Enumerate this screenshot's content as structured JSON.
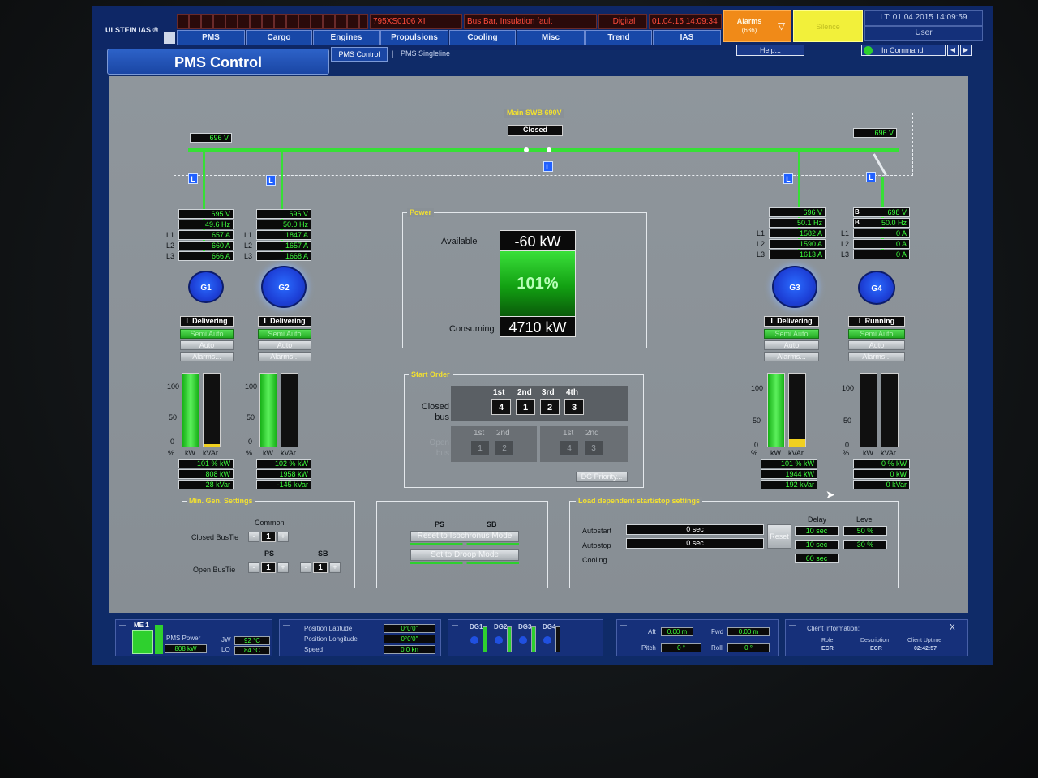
{
  "app": {
    "brand": "ULSTEIN IAS ®"
  },
  "topbar": {
    "alarm_code": "795XS0106 XI",
    "alarm_text": "Bus Bar, Insulation fault",
    "alarm_type": "Digital",
    "alarm_time": "01.04.15 14:09:34",
    "alarms_label": "Alarms",
    "alarms_count": "(636)",
    "silence_label": "Silence",
    "clock": "LT: 01.04.2015 14:09:59",
    "user_label": "User"
  },
  "menu": [
    "PMS",
    "Cargo",
    "Engines",
    "Propulsions",
    "Cooling",
    "Misc",
    "Trend",
    "IAS"
  ],
  "page": {
    "title": "PMS Control",
    "tab_active": "PMS Control",
    "tab_sep": "|",
    "tab_other": "PMS Singleline",
    "help": "Help...",
    "in_command": "In Command"
  },
  "swb": {
    "title": "Main SWB 690V",
    "tie_status": "Closed",
    "left_voltage": "696 V",
    "right_voltage": "696 V",
    "L_label": "L"
  },
  "phase_labels": [
    "L1",
    "L2",
    "L3"
  ],
  "bar_labels": {
    "pct": "%",
    "kw": "kW",
    "kvar": "kVAr",
    "s100": "100",
    "s50": "50",
    "s0": "0"
  },
  "generators": [
    {
      "id": "G1",
      "v": "695 V",
      "hz": "49.6 Hz",
      "l1": "657 A",
      "l2": "660 A",
      "l3": "666 A",
      "status": "L Delivering",
      "mode1": "Semi Auto",
      "mode2": "Auto",
      "alarms": "Alarms...",
      "kw_pct": 101,
      "kvar_pct": 3,
      "pct": "101 % kW",
      "kw": "808 kW",
      "kvar": "28 kVar"
    },
    {
      "id": "G2",
      "v": "696 V",
      "hz": "50.0 Hz",
      "l1": "1847 A",
      "l2": "1657 A",
      "l3": "1668 A",
      "status": "L Delivering",
      "mode1": "Semi Auto",
      "mode2": "Auto",
      "alarms": "Alarms...",
      "kw_pct": 102,
      "kvar_pct": 0,
      "pct": "102 % kW",
      "kw": "1958 kW",
      "kvar": "-145 kVar"
    },
    {
      "id": "G3",
      "v": "696 V",
      "hz": "50.1 Hz",
      "l1": "1582 A",
      "l2": "1590 A",
      "l3": "1613 A",
      "status": "L Delivering",
      "mode1": "Semi Auto",
      "mode2": "Auto",
      "alarms": "Alarms...",
      "kw_pct": 101,
      "kvar_pct": 10,
      "pct": "101 % kW",
      "kw": "1944 kW",
      "kvar": "192 kVar"
    },
    {
      "id": "G4",
      "v": "698 V",
      "hz": "50.0 Hz",
      "l1": "0 A",
      "l2": "0 A",
      "l3": "0 A",
      "status": "L Running",
      "mode1": "Semi Auto",
      "mode2": "Auto",
      "alarms": "Alarms...",
      "kw_pct": 0,
      "kvar_pct": 0,
      "pct": "0 % kW",
      "kw": "0 kW",
      "kvar": "0 kVar",
      "b1": "B",
      "b2": "B"
    }
  ],
  "power": {
    "title": "Power",
    "available_label": "Available",
    "available": "-60 kW",
    "percent": "101%",
    "consuming_label": "Consuming",
    "consuming": "4710 kW"
  },
  "start_order": {
    "title": "Start Order",
    "closed_bus_label": "Closed bus",
    "open_bus_label": "Open bus",
    "headers": [
      "1st",
      "2nd",
      "3rd",
      "4th"
    ],
    "closed_values": [
      "4",
      "1",
      "2",
      "3"
    ],
    "open_left_headers": [
      "1st",
      "2nd"
    ],
    "open_left_values": [
      "1",
      "2"
    ],
    "open_right_headers": [
      "1st",
      "2nd"
    ],
    "open_right_values": [
      "4",
      "3"
    ],
    "dg_priority": "DG Priority..."
  },
  "min_gen": {
    "title": "Min. Gen. Settings",
    "common": "Common",
    "closed_bustie": "Closed BusTie",
    "open_bustie": "Open BusTie",
    "ps": "PS",
    "sb": "SB",
    "closed_value": "1",
    "open_ps_value": "1",
    "open_sb_value": "1",
    "minus": "-",
    "plus": "+"
  },
  "mode_box": {
    "ps": "PS",
    "sb": "SB",
    "isochronous": "Reset to Isochronus Mode",
    "droop": "Set to Droop Mode"
  },
  "load_dep": {
    "title": "Load dependent start/stop settings",
    "delay": "Delay",
    "level": "Level",
    "autostart": "Autostart",
    "autostop": "Autostop",
    "cooling": "Cooling",
    "autostart_val": "0 sec",
    "autostop_val": "0 sec",
    "reset": "Reset",
    "delay_vals": [
      "10 sec",
      "10 sec",
      "60 sec"
    ],
    "level_vals": [
      "50 %",
      "30 %"
    ]
  },
  "bottom": {
    "dash": "—",
    "me": "ME 1",
    "pms_power": "PMS Power",
    "pms_kw": "808 kW",
    "jw": "JW",
    "lo": "LO",
    "jw_val": "92 °C",
    "lo_val": "84 °C",
    "pos_lat": "Position Latitude",
    "pos_lon": "Position Longitude",
    "speed": "Speed",
    "lat_val": "0°0'0\"",
    "lon_val": "0°0'0\"",
    "speed_val": "0.0 kn",
    "dg": [
      "DG1",
      "DG2",
      "DG3",
      "DG4"
    ],
    "aft": "Aft",
    "fwd": "Fwd",
    "pitch": "Pitch",
    "roll": "Roll",
    "aft_val": "0.00 m",
    "fwd_val": "0.00 m",
    "pitch_val": "0 °",
    "roll_val": "0 °",
    "client_info": "Client Information:",
    "close": "X",
    "role": "Role",
    "role_val": "ECR",
    "description": "Description",
    "description_val": "ECR",
    "uptime": "Client Uptime",
    "uptime_val": "02:42:57"
  }
}
